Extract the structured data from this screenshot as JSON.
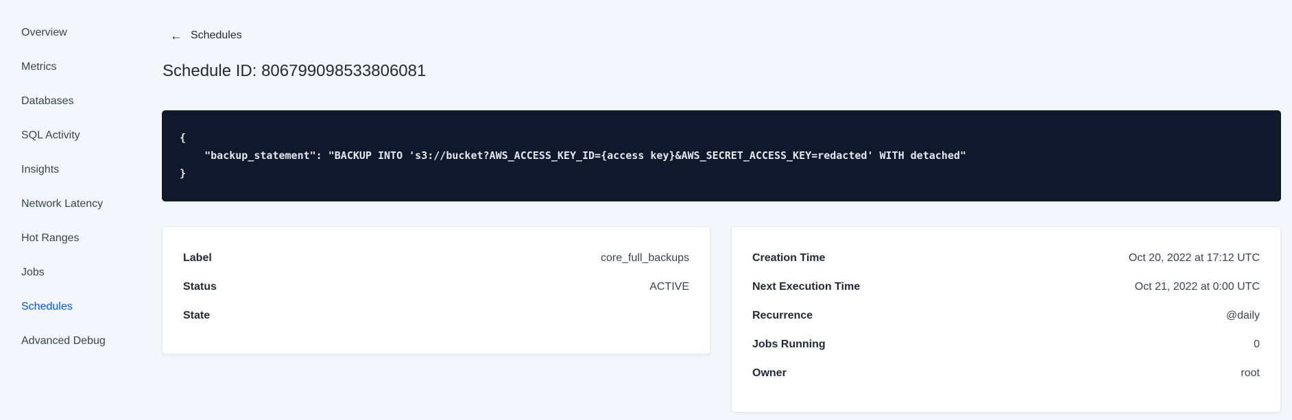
{
  "sidebar": {
    "items": [
      {
        "label": "Overview",
        "active": false
      },
      {
        "label": "Metrics",
        "active": false
      },
      {
        "label": "Databases",
        "active": false
      },
      {
        "label": "SQL Activity",
        "active": false
      },
      {
        "label": "Insights",
        "active": false
      },
      {
        "label": "Network Latency",
        "active": false
      },
      {
        "label": "Hot Ranges",
        "active": false
      },
      {
        "label": "Jobs",
        "active": false
      },
      {
        "label": "Schedules",
        "active": true
      },
      {
        "label": "Advanced Debug",
        "active": false
      }
    ]
  },
  "header": {
    "back_icon_glyph": "←",
    "back_label": "Schedules",
    "title": "Schedule ID: 806799098533806081"
  },
  "code_block": {
    "lines": [
      "{",
      "    \"backup_statement\": \"BACKUP INTO 's3://bucket?AWS_ACCESS_KEY_ID={access key}&AWS_SECRET_ACCESS_KEY=redacted' WITH detached\"",
      "}"
    ]
  },
  "details_card": {
    "rows": [
      {
        "label": "Label",
        "value": "core_full_backups"
      },
      {
        "label": "Status",
        "value": "ACTIVE"
      },
      {
        "label": "State",
        "value": ""
      }
    ]
  },
  "schedule_card": {
    "rows": [
      {
        "label": "Creation Time",
        "value": "Oct 20, 2022 at 17:12 UTC"
      },
      {
        "label": "Next Execution Time",
        "value": "Oct 21, 2022 at 0:00 UTC"
      },
      {
        "label": "Recurrence",
        "value": "@daily"
      },
      {
        "label": "Jobs Running",
        "value": "0"
      },
      {
        "label": "Owner",
        "value": "root"
      }
    ]
  },
  "colors": {
    "active_link": "#0055ff",
    "page_background": "#f3f6fa",
    "code_background": "#10182b",
    "code_text": "#e3e8f0",
    "text_primary": "#242a35",
    "text_secondary": "#394455",
    "card_background": "#ffffff"
  }
}
